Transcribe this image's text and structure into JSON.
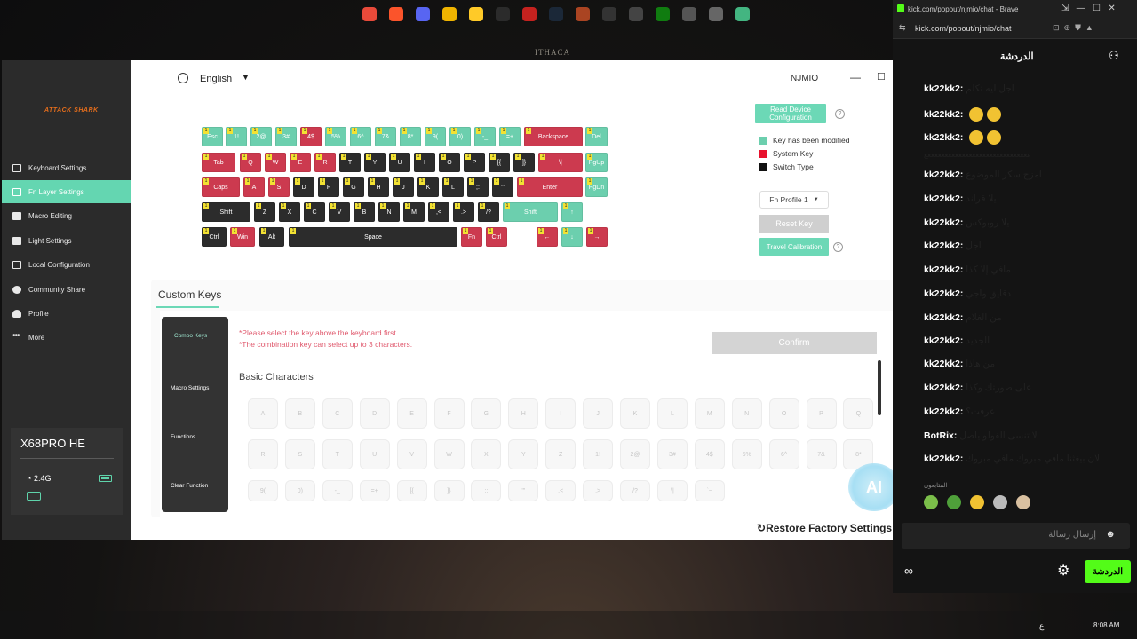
{
  "desktop": {
    "bg_text": "ITHACA"
  },
  "app": {
    "logo": "ATTACK SHARK",
    "nav": [
      {
        "label": "Keyboard Settings",
        "icon": "keyboard-icon"
      },
      {
        "label": "Fn Layer Settings",
        "icon": "layer-icon",
        "active": true
      },
      {
        "label": "Macro Editing",
        "icon": "macro-icon"
      },
      {
        "label": "Light Settings",
        "icon": "light-icon"
      },
      {
        "label": "Local Configuration",
        "icon": "config-icon"
      },
      {
        "label": "Community Share",
        "icon": "community-icon"
      },
      {
        "label": "Profile",
        "icon": "profile-icon"
      },
      {
        "label": "More",
        "icon": "more-icon"
      }
    ],
    "device": {
      "name": "X68PRO HE",
      "conn": "2.4G"
    },
    "language": "English",
    "user": "NJMIO",
    "read_device": "Read Device Configuration",
    "legend": [
      {
        "label": "Key has been modified",
        "color": "#6ccfae"
      },
      {
        "label": "System Key",
        "color": "#e8112d"
      },
      {
        "label": "Switch Type",
        "color": "#111111"
      }
    ],
    "fn_profile": "Fn Profile 1",
    "reset_key": "Reset Key",
    "travel": "Travel Calibration",
    "custom_keys": "Custom Keys",
    "tabs": [
      "Combo Keys",
      "Macro Settings",
      "Functions",
      "Clear Function"
    ],
    "warn1": "*Please select the key above the keyboard first",
    "warn2": "*The combination key can select up to 3 characters.",
    "confirm": "Confirm",
    "basic": "Basic Characters",
    "chars_row1": [
      "A",
      "B",
      "C",
      "D",
      "E",
      "F",
      "G",
      "H",
      "I",
      "J",
      "K",
      "L",
      "M",
      "N",
      "O",
      "P",
      "Q"
    ],
    "chars_row2": [
      "R",
      "S",
      "T",
      "U",
      "V",
      "W",
      "X",
      "Y",
      "Z",
      "1!",
      "2@",
      "3#",
      "4$",
      "5%",
      "6^",
      "7&",
      "8*"
    ],
    "chars_row3": [
      "9(",
      "0)",
      "-_",
      "=+",
      "[{",
      "]}",
      ";:",
      "'\"",
      ",<",
      ".>",
      "/?",
      "\\|",
      "`~"
    ],
    "ai": "AI",
    "restore": "Restore Factory Settings"
  },
  "browser": {
    "title": "kick.com/popout/njmio/chat - Brave",
    "url": "kick.com/popout/njmio/chat",
    "chat_header": "الدردشة",
    "messages": [
      {
        "user": "kk22kk2:",
        "text": "اجل ليه تكلم"
      },
      {
        "user": "kk22kk2:",
        "text": ""
      },
      {
        "user": "kk22kk2:",
        "text": ""
      },
      {
        "user": "",
        "text": "ععععععععععععععععععععععععععععععع"
      },
      {
        "user": "kk22kk2:",
        "text": "امزح سكر الموضوع"
      },
      {
        "user": "kk22kk2:",
        "text": "يلا قراند"
      },
      {
        "user": "kk22kk2:",
        "text": "يلا روبوكس"
      },
      {
        "user": "kk22kk2:",
        "text": "اجل"
      },
      {
        "user": "kk22kk2:",
        "text": "مافي إلا كذا"
      },
      {
        "user": "kk22kk2:",
        "text": "دقايق واجي"
      },
      {
        "user": "kk22kk2:",
        "text": "من الغلام"
      },
      {
        "user": "kk22kk2:",
        "text": "الجديد"
      },
      {
        "user": "kk22kk2:",
        "text": "من هاذا"
      },
      {
        "user": "kk22kk2:",
        "text": "على صورتك وكذا"
      },
      {
        "user": "kk22kk2:",
        "text": "عرفت؟"
      },
      {
        "user": "BotRix:",
        "text": "لا تنسى الفولو ياصل"
      },
      {
        "user": "kk22kk2:",
        "text": "الان بيغثنا مافي مبروك مافي مبروك"
      }
    ],
    "followers": "المتابعون",
    "input_placeholder": "إرسال رسالة",
    "chat_button": "الدردشة"
  },
  "taskbar": {
    "time": "8:08 AM",
    "lang": "ع"
  }
}
